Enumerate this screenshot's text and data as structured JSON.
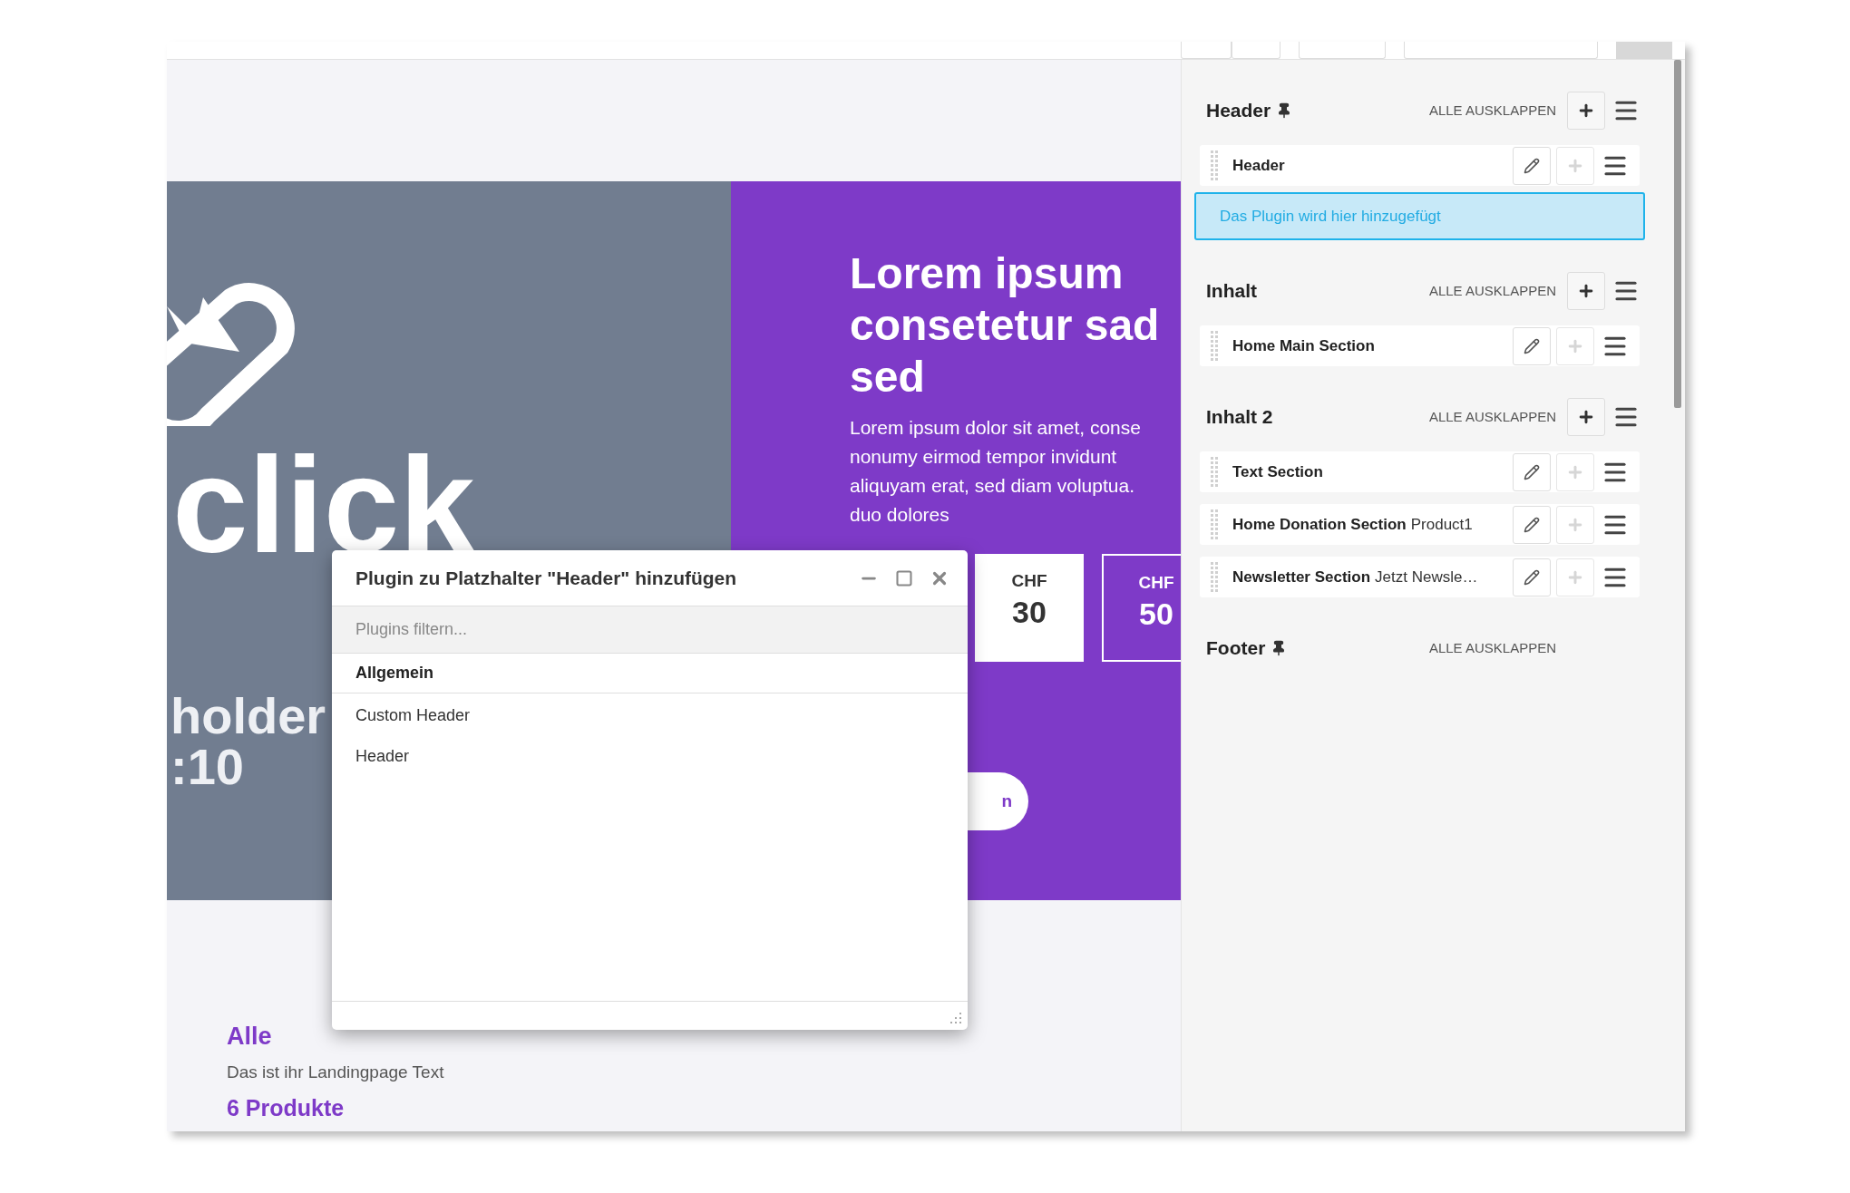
{
  "page": {
    "hero": {
      "logo_word": "click",
      "caption_lines": [
        "holder",
        ":10"
      ],
      "headline_lines": [
        "Lorem ipsum",
        "consetetur sad",
        "sed"
      ],
      "body_lines": [
        "Lorem ipsum dolor sit amet, conse",
        "nonumy eirmod tempor invidunt",
        "aliquyam erat, sed diam voluptua.",
        "duo dolores"
      ],
      "prices": [
        {
          "currency": "CHF",
          "amount": "30",
          "selected": false
        },
        {
          "currency": "CHF",
          "amount": "50",
          "selected": true
        }
      ],
      "button_label": "n"
    },
    "intro": {
      "title": "Alle",
      "text": "Das ist ihr Landingpage Text",
      "count": "6 Produkte"
    }
  },
  "dialog": {
    "title": "Plugin zu Platzhalter \"Header\" hinzufügen",
    "filter": {
      "placeholder": "Plugins filtern..."
    },
    "groups": [
      {
        "label": "Allgemein",
        "items": [
          "Custom Header",
          "Header"
        ]
      }
    ]
  },
  "structure": {
    "placeholders": [
      {
        "title": "Header",
        "pinned": true,
        "expand_label": "ALLE AUSKLAPPEN",
        "can_add": true,
        "plugins": [
          {
            "name": "Header",
            "add_disabled": true
          }
        ],
        "drop_hint": "Das Plugin wird hier hinzugefügt"
      },
      {
        "title": "Inhalt",
        "pinned": false,
        "expand_label": "ALLE AUSKLAPPEN",
        "can_add": true,
        "plugins": [
          {
            "name": "Home Main Section",
            "add_disabled": true
          }
        ]
      },
      {
        "title": "Inhalt 2",
        "pinned": false,
        "expand_label": "ALLE AUSKLAPPEN",
        "can_add": true,
        "plugins": [
          {
            "name": "Text Section",
            "add_disabled": true
          },
          {
            "name": "Home Donation Section",
            "detail": "Product1",
            "add_disabled": true
          },
          {
            "name": "Newsletter Section",
            "detail": "Jetzt Newsle…",
            "add_disabled": true
          }
        ]
      },
      {
        "title": "Footer",
        "pinned": true,
        "expand_label": "ALLE AUSKLAPPEN",
        "can_add": false
      }
    ]
  }
}
